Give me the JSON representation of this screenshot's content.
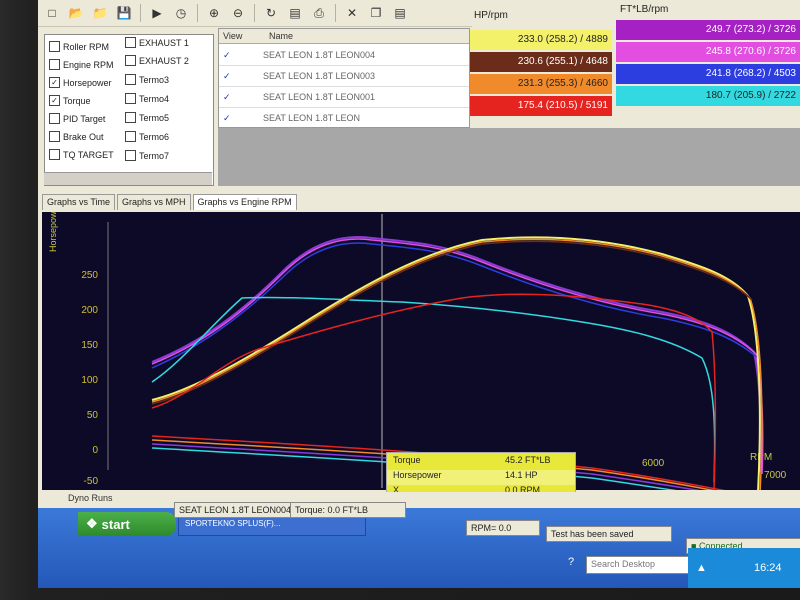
{
  "toolbar": {
    "icons": [
      "new-file-icon",
      "open-folder-icon",
      "open-icon",
      "save-icon",
      "play-icon",
      "timer-icon",
      "zoom-in-icon",
      "zoom-out-icon",
      "refresh-icon",
      "print-preview-icon",
      "print-icon",
      "cut-icon",
      "copy-icon",
      "paste-icon"
    ]
  },
  "checkbox_panel": {
    "left_column": [
      {
        "label": "Roller RPM",
        "checked": false
      },
      {
        "label": "Engine RPM",
        "checked": false
      },
      {
        "label": "Horsepower",
        "checked": true
      },
      {
        "label": "Torque",
        "checked": true
      },
      {
        "label": "PID Target",
        "checked": false
      },
      {
        "label": "Brake Out",
        "checked": false
      },
      {
        "label": "TQ TARGET",
        "checked": false
      }
    ],
    "right_column": [
      {
        "label": "EXHAUST 1",
        "checked": false
      },
      {
        "label": "EXHAUST 2",
        "checked": false
      },
      {
        "label": "Termo3",
        "checked": false
      },
      {
        "label": "Termo4",
        "checked": false
      },
      {
        "label": "Termo5",
        "checked": false
      },
      {
        "label": "Termo6",
        "checked": false
      },
      {
        "label": "Termo7",
        "checked": false
      }
    ]
  },
  "runs": {
    "headers": {
      "view": "View",
      "name": "Name",
      "hp": "HP/rpm",
      "ft": "FT*LB/rpm"
    },
    "rows": [
      {
        "name": "SEAT LEON 1.8T LEON004",
        "hp": "233.0 (258.2) / 4889",
        "ft": "249.7 (273.2) / 3726",
        "hp_color": "#f3f06a",
        "ft_color": "#a521c4"
      },
      {
        "name": "SEAT LEON 1.8T LEON003",
        "hp": "230.6 (255.1) / 4648",
        "ft": "245.8 (270.6) / 3726",
        "hp_color": "#6b2d1a",
        "ft_color": "#e24fe0"
      },
      {
        "name": "SEAT LEON 1.8T LEON001",
        "hp": "231.3 (255.3) / 4660",
        "ft": "241.8 (268.2) / 4503",
        "hp_color": "#f08a2a",
        "ft_color": "#2c3ee0"
      },
      {
        "name": "SEAT LEON 1.8T LEON",
        "hp": "175.4 (210.5) / 5191",
        "ft": "180.7 (205.9) / 2722",
        "hp_color": "#e52420",
        "ft_color": "#32d9e0"
      }
    ]
  },
  "tabs": [
    "Graphs vs Time",
    "Graphs vs MPH",
    "Graphs vs Engine RPM"
  ],
  "active_tab": 2,
  "graph": {
    "y_axis_title": "Horsepower",
    "y_ticks": [
      "250",
      "200",
      "150",
      "100",
      "50",
      "0",
      "-50"
    ],
    "x_ticks": [
      "6000",
      "7000"
    ],
    "x_axis_title": "RPM"
  },
  "cursor_readout": {
    "rows": [
      {
        "label": "Torque",
        "value": "45.2 FT*LB"
      },
      {
        "label": "Horsepower",
        "value": "14.1 HP"
      },
      {
        "label": "X",
        "value": "0.0 RPM"
      }
    ]
  },
  "status": {
    "runs_label": "Dyno Runs",
    "current_run": "SEAT LEON 1.8T LEON004",
    "torque_readout": "Torque: 0.0 FT*LB",
    "rpm_readout": "RPM= 0.0",
    "test_status": "Test has been saved",
    "connection": "Connected"
  },
  "taskbar": {
    "start_label": "start",
    "window_button": "SPORTEKNO SPLUS(F)...",
    "search_placeholder": "Search Desktop",
    "clock": "16:24"
  }
}
